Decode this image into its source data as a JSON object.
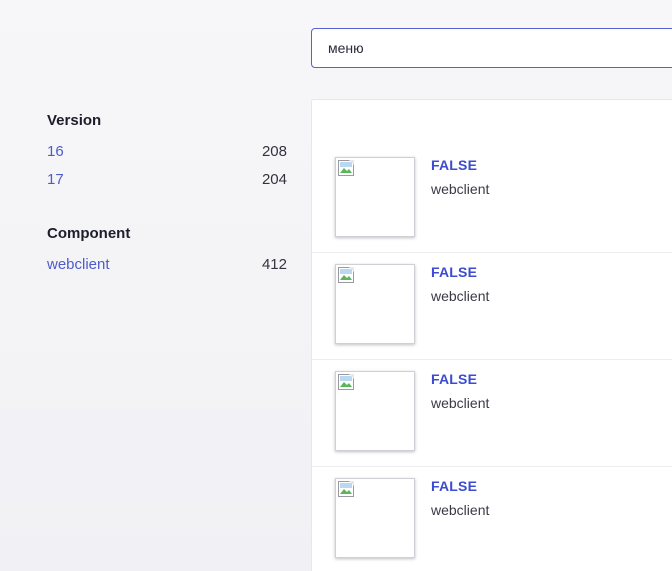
{
  "search": {
    "value": "меню",
    "placeholder": ""
  },
  "facets": {
    "version": {
      "title": "Version",
      "items": [
        {
          "label": "16",
          "count": "208"
        },
        {
          "label": "17",
          "count": "204"
        }
      ]
    },
    "component": {
      "title": "Component",
      "items": [
        {
          "label": "webclient",
          "count": "412"
        }
      ]
    }
  },
  "results": [
    {
      "title": "FALSE",
      "subtitle": "webclient",
      "thumbnail_icon": "broken-image-icon"
    },
    {
      "title": "FALSE",
      "subtitle": "webclient",
      "thumbnail_icon": "broken-image-icon"
    },
    {
      "title": "FALSE",
      "subtitle": "webclient",
      "thumbnail_icon": "broken-image-icon"
    },
    {
      "title": "FALSE",
      "subtitle": "webclient",
      "thumbnail_icon": "broken-image-icon"
    }
  ],
  "colors": {
    "accent": "#5661d6",
    "link": "#4e5bc8",
    "title_link": "#3c4bd0"
  }
}
